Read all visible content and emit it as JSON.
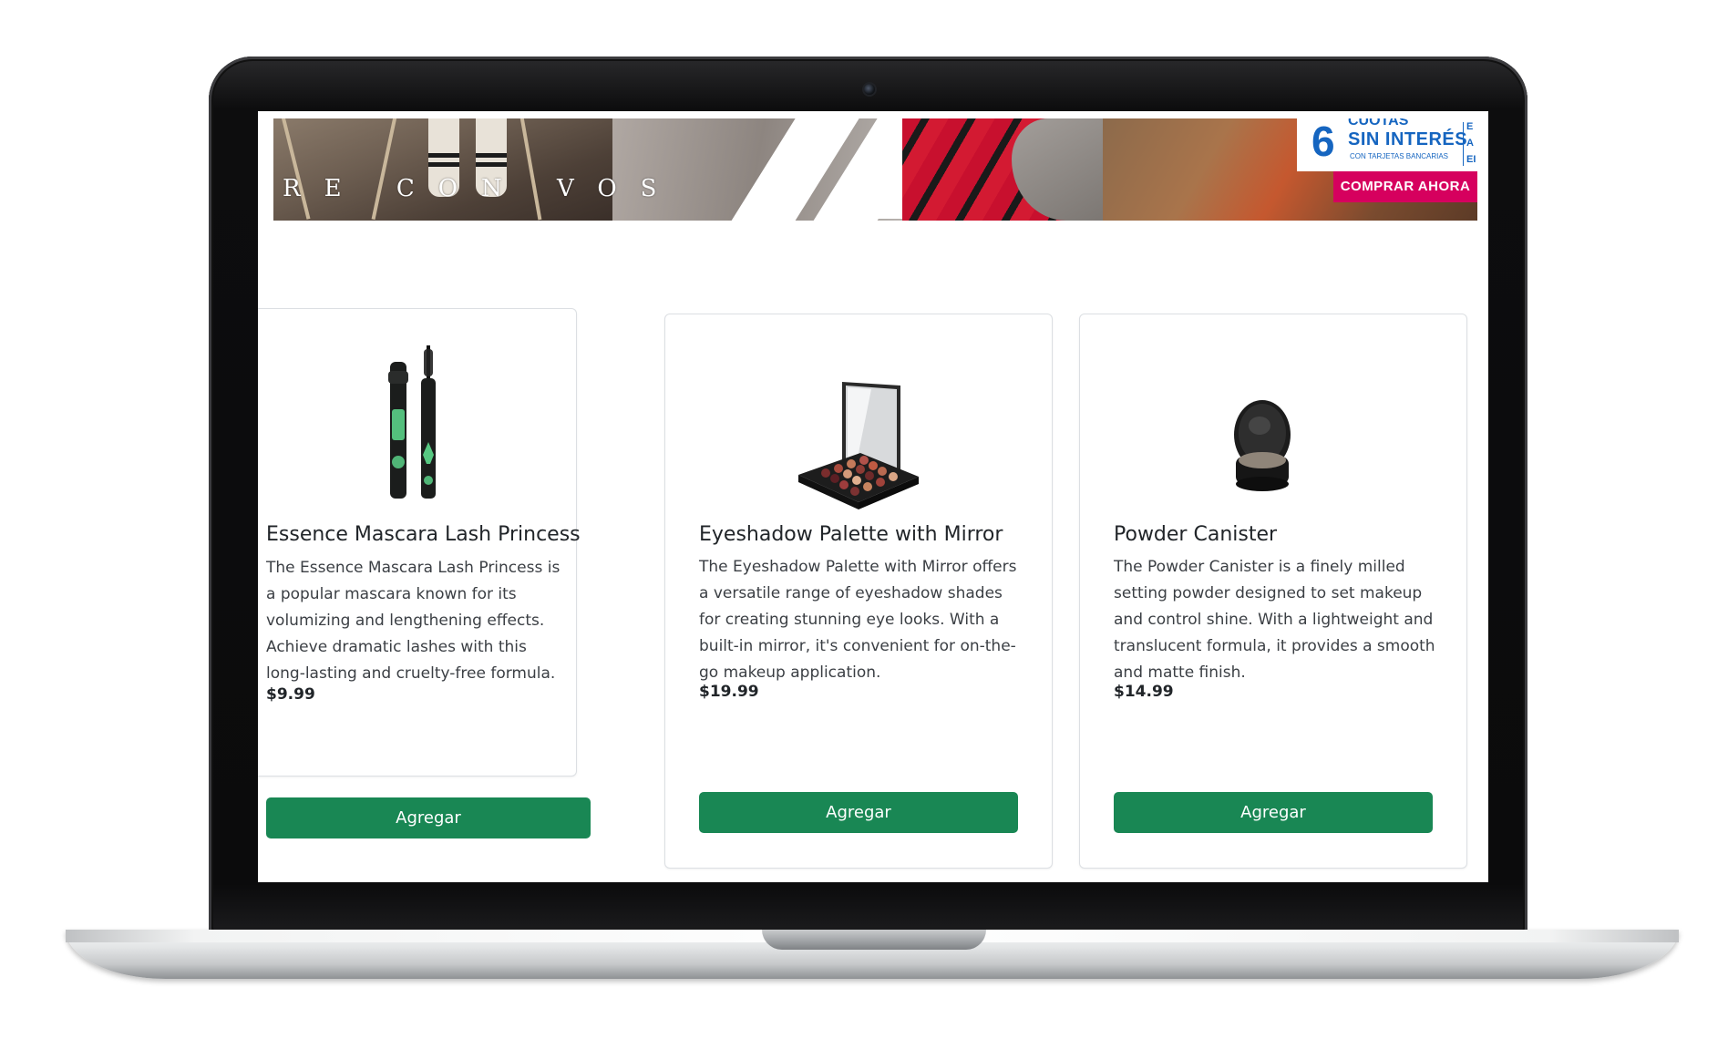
{
  "banner": {
    "tagline": "RE CON VOS",
    "promo_number": "6",
    "promo_top": "CUOTAS",
    "promo_line1": "SIN INTERÉS",
    "promo_line2": "CON TARJETAS BANCARIAS",
    "promo_side": "E A EI",
    "cta_label": "COMPRAR AHORA",
    "cta_color": "#d6005e",
    "promo_text_color": "#1565c0"
  },
  "products": [
    {
      "name": "Essence Mascara Lash Princess",
      "description": "The Essence Mascara Lash Princess is a popular mascara known for its volumizing and lengthening effects. Achieve dramatic lashes with this long-lasting and cruelty-free formula.",
      "price": "$9.99",
      "button_label": "Agregar",
      "icon": "mascara-icon"
    },
    {
      "name": "Eyeshadow Palette with Mirror",
      "description": "The Eyeshadow Palette with Mirror offers a versatile range of eyeshadow shades for creating stunning eye looks. With a built-in mirror, it's convenient for on-the-go makeup application.",
      "price": "$19.99",
      "button_label": "Agregar",
      "icon": "eyeshadow-palette-icon"
    },
    {
      "name": "Powder Canister",
      "description": "The Powder Canister is a finely milled setting powder designed to set makeup and control shine. With a lightweight and translucent formula, it provides a smooth and matte finish.",
      "price": "$14.99",
      "button_label": "Agregar",
      "icon": "powder-canister-icon"
    }
  ],
  "colors": {
    "button": "#198754",
    "card_border": "#dcdfe3"
  }
}
